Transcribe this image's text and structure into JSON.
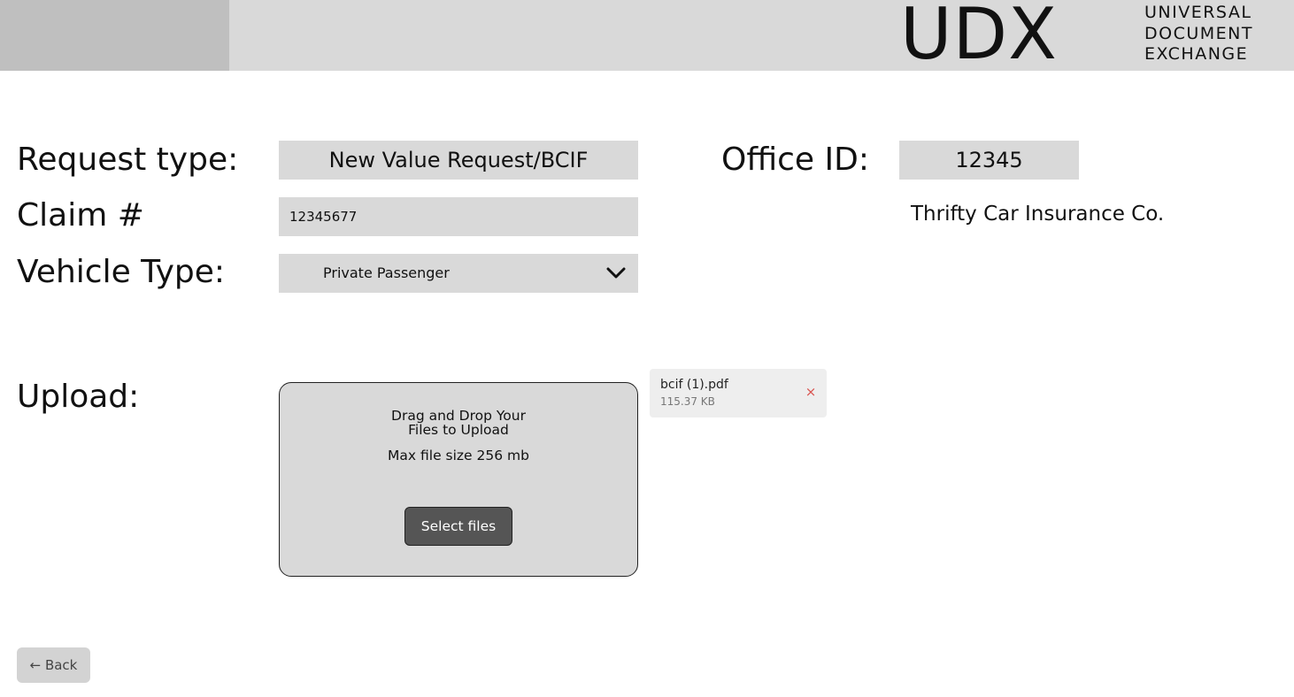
{
  "header": {
    "logo_mark": "UDX",
    "logo_lines": [
      "UNIVERSAL",
      "DOCUMENT",
      "EXCHANGE"
    ]
  },
  "form": {
    "request_type_label": "Request type:",
    "request_type_value": "New Value Request/BCIF",
    "claim_label": "Claim #",
    "claim_value": "12345677",
    "vehicle_type_label": "Vehicle Type:",
    "vehicle_type_value": "Private Passenger",
    "office_id_label": "Office ID:",
    "office_id_value": "12345",
    "company_name": "Thrifty Car Insurance Co."
  },
  "upload": {
    "label": "Upload:",
    "drop_title_line1": "Drag and Drop Your",
    "drop_title_line2": "Files to Upload",
    "max_size": "Max file size 256 mb",
    "select_button": "Select files",
    "files": [
      {
        "name": "bcif (1).pdf",
        "size": "115.37 KB",
        "remove_icon": "×"
      }
    ]
  },
  "footer": {
    "back_label": "← Back"
  },
  "colors": {
    "header_bg": "#d9d9d9",
    "header_left_block": "#bfbfbf",
    "field_bg": "#d9d9d9",
    "select_button_bg": "#555555",
    "remove_icon": "#d9534f",
    "back_button_bg": "#d3d3d3"
  },
  "icons": {
    "vehicle_dropdown": "chevron-down-icon",
    "file_remove": "close-icon"
  }
}
